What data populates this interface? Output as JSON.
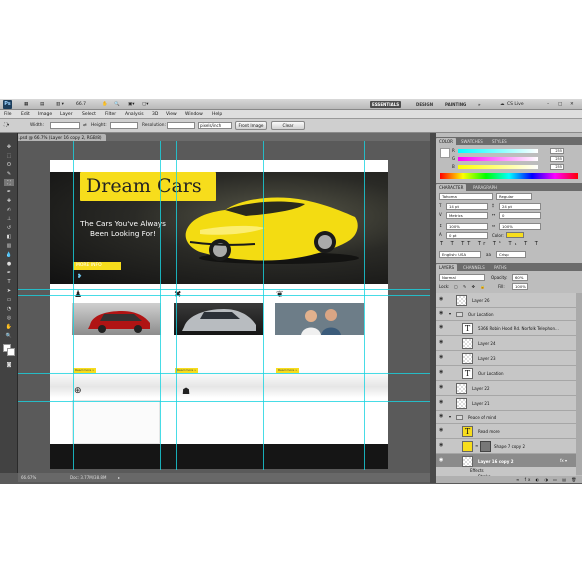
{
  "app": {
    "logo": "Ps",
    "zoom_readout": "66.7",
    "workspaces": [
      "ESSENTIALS",
      "DESIGN",
      "PAINTING",
      "»"
    ],
    "cs_live": "CS Live"
  },
  "menu": [
    "File",
    "Edit",
    "Image",
    "Layer",
    "Select",
    "Filter",
    "Analysis",
    "3D",
    "View",
    "Window",
    "Help"
  ],
  "options": {
    "width_label": "Width:",
    "height_label": "Height:",
    "resolution_label": "Resolution:",
    "resolution_unit": "pixels/inch",
    "front_image": "Front Image",
    "clear": "Clear"
  },
  "document": {
    "tab_title": "car-3.psd @ 66.7% (Layer 16 copy 2, RGB/8)",
    "status_zoom": "66.67%",
    "status_doc": "Doc: 3.77M/38.8M"
  },
  "site": {
    "logo": "Dream Cars",
    "tagline_line1": "The Cars You've Always",
    "tagline_line2": "Been Looking For!",
    "more_info": "MORE INFO",
    "feature_links": [
      "Read more »",
      "Read more »",
      "Read more »"
    ]
  },
  "panels": {
    "color_tabs": [
      "COLOR",
      "SWATCHES",
      "STYLES"
    ],
    "rgb": {
      "r": "255",
      "g": "255",
      "b": "255"
    },
    "char_tabs": [
      "CHARACTER",
      "PARAGRAPH"
    ],
    "font_family": "Tahoma",
    "font_style": "Regular",
    "font_size": "14 pt",
    "leading": "24 pt",
    "kerning": "Metrics",
    "tracking": "0",
    "vscale": "100%",
    "hscale": "100%",
    "baseline": "0 pt",
    "color_label": "Color:",
    "language": "English: USA",
    "aa_label": "aa",
    "antialias": "Crisp"
  },
  "layers": {
    "tabs": [
      "LAYERS",
      "CHANNELS",
      "PATHS"
    ],
    "blend": "Normal",
    "opacity_label": "Opacity:",
    "opacity": "60%",
    "lock_label": "Lock:",
    "fill_label": "Fill:",
    "fill": "100%",
    "rows": [
      {
        "name": "Layer 26",
        "kind": "pixel"
      },
      {
        "name": "Our Location",
        "kind": "group"
      },
      {
        "name": "5366 Robin Hood Rd. Norfolk Telephon...",
        "kind": "text"
      },
      {
        "name": "Layer 24",
        "kind": "pixel"
      },
      {
        "name": "Layer 23",
        "kind": "pixel"
      },
      {
        "name": "Our Location",
        "kind": "text"
      },
      {
        "name": "Layer 22",
        "kind": "pixel"
      },
      {
        "name": "Layer 21",
        "kind": "pixel"
      },
      {
        "name": "Peace of mind",
        "kind": "group"
      },
      {
        "name": "Read more",
        "kind": "text"
      },
      {
        "name": "Shape 7 copy 2",
        "kind": "shape"
      },
      {
        "name": "Layer 16 copy 2",
        "kind": "selected"
      },
      {
        "name": "Effects",
        "kind": "effects"
      },
      {
        "name": "Stroke",
        "kind": "effects"
      }
    ]
  },
  "colors": {
    "accent_yellow": "#f7dd1c",
    "guide": "#19d3e0",
    "ps_gray": "#5a5a5a"
  }
}
